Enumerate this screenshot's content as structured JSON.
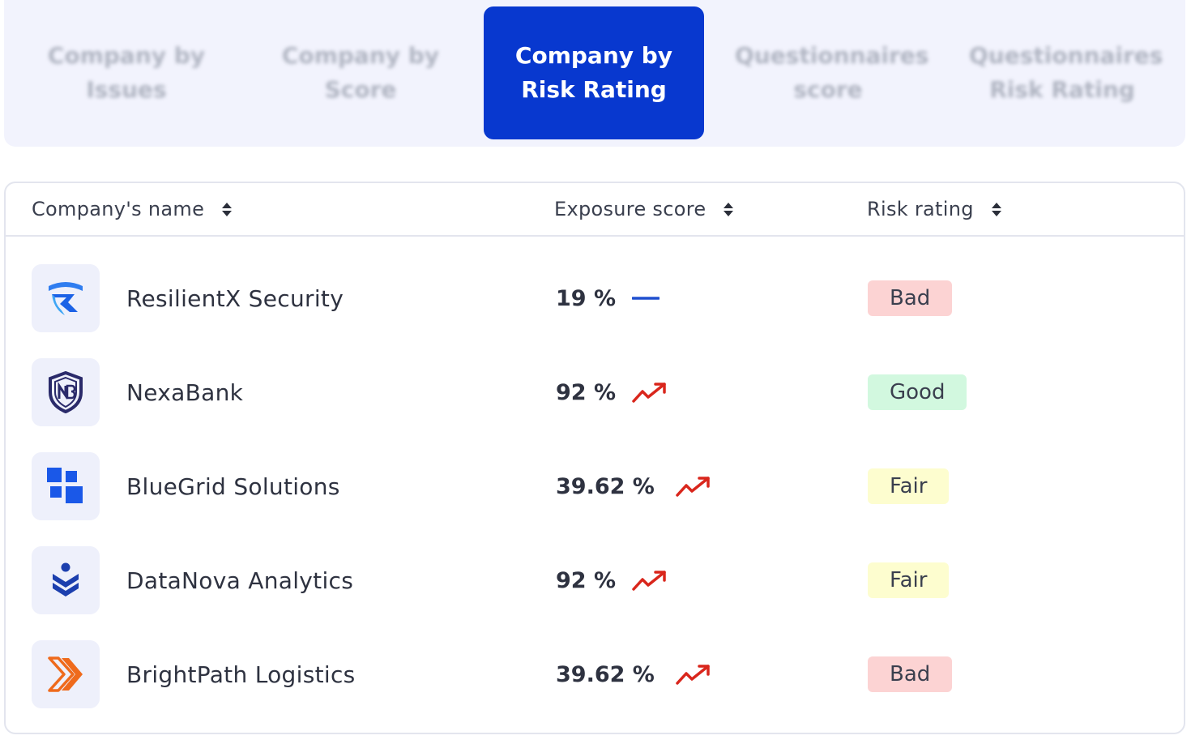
{
  "tabs": [
    {
      "label": "Company by Issues",
      "active": false
    },
    {
      "label": "Company by Score",
      "active": false
    },
    {
      "label": "Company by Risk Rating",
      "active": true
    },
    {
      "label": "Questionnaires score",
      "active": false
    },
    {
      "label": "Questionnaires Risk Rating",
      "active": false
    }
  ],
  "table": {
    "columns": [
      "Company's name",
      "Exposure score",
      "Risk rating"
    ],
    "rows": [
      {
        "name": "ResilientX Security",
        "logo": "resilientx-shield-icon",
        "score": "19 %",
        "trend": "flat",
        "rating": "Bad"
      },
      {
        "name": "NexaBank",
        "logo": "nexabank-shield-icon",
        "score": "92 %",
        "trend": "up",
        "rating": "Good"
      },
      {
        "name": "BlueGrid Solutions",
        "logo": "bluegrid-squares-icon",
        "score": "39.62 %",
        "trend": "up",
        "rating": "Fair"
      },
      {
        "name": "DataNova Analytics",
        "logo": "datanova-layers-icon",
        "score": "92 %",
        "trend": "up",
        "rating": "Fair"
      },
      {
        "name": "BrightPath Logistics",
        "logo": "brightpath-chevrons-icon",
        "score": "39.62 %",
        "trend": "up",
        "rating": "Bad"
      }
    ]
  },
  "colors": {
    "active_tab": "#0838cf",
    "tab_bar_bg": "#f2f3fd",
    "trend_up": "#d9261c",
    "trend_flat": "#1f4fcf",
    "rating_bad": "#fcd3d3",
    "rating_good": "#d2f8df",
    "rating_fair": "#fdfdcf"
  }
}
